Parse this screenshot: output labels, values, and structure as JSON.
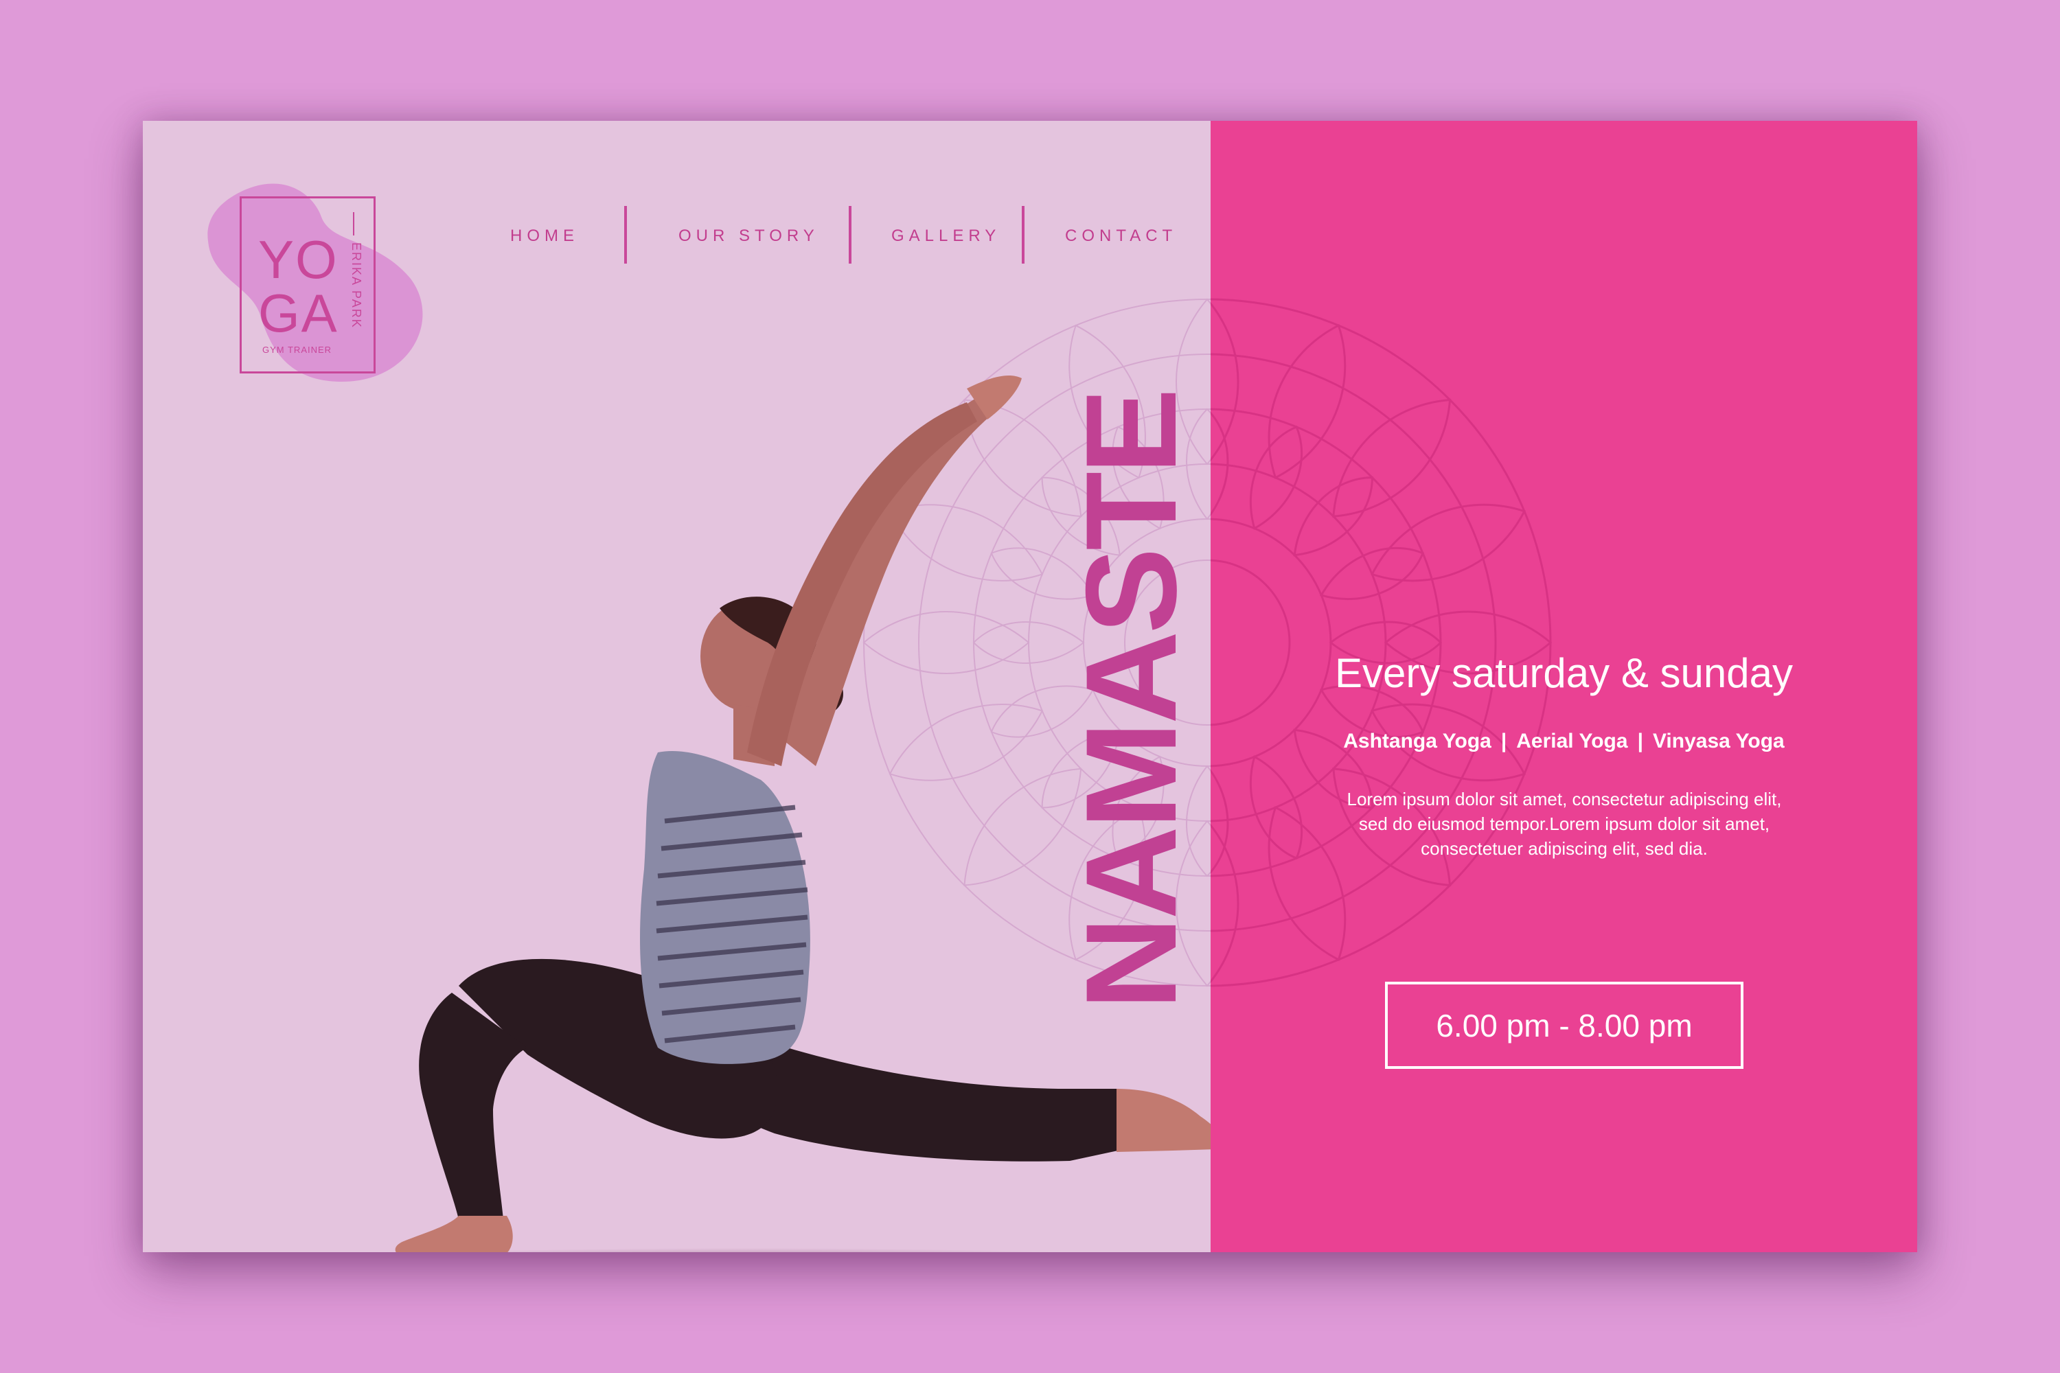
{
  "colors": {
    "page_background": "#df9ad8",
    "left_panel": "#e4c4de",
    "right_panel": "#ea4193",
    "accent": "#c9479a"
  },
  "logo": {
    "line1": "YO",
    "line2": "GA",
    "subtitle": "GYM TRAINER",
    "side_text": "ERIKA PARK"
  },
  "nav": {
    "items": [
      {
        "label": "HOME"
      },
      {
        "label": "OUR STORY"
      },
      {
        "label": "GALLERY"
      },
      {
        "label": "CONTACT"
      }
    ]
  },
  "hero": {
    "vertical_word": "NAMASTE"
  },
  "info": {
    "days": "Every saturday & sunday",
    "styles": [
      "Ashtanga Yoga",
      "Aerial Yoga",
      "Vinyasa Yoga"
    ],
    "separator": "|",
    "description": "Lorem ipsum dolor sit amet, consectetur adipiscing elit, sed do eiusmod tempor.Lorem ipsum dolor sit amet, consectetuer adipiscing elit, sed dia.",
    "time": "6.00 pm - 8.00 pm"
  }
}
